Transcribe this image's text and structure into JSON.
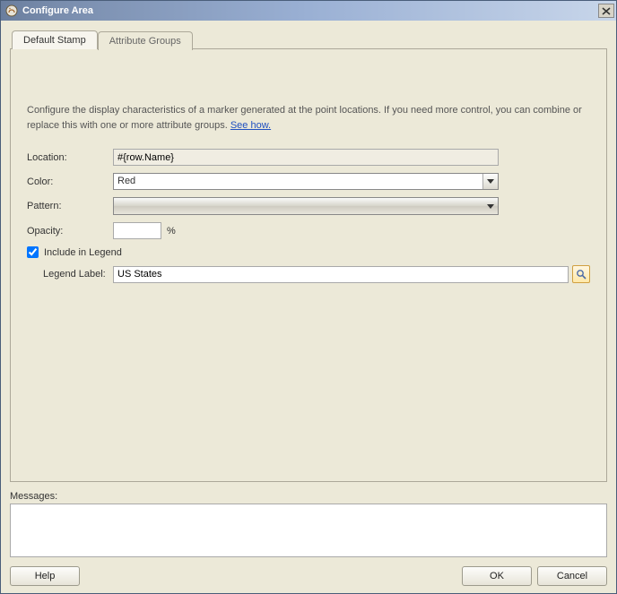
{
  "window": {
    "title": "Configure Area"
  },
  "tabs": {
    "default_stamp": "Default Stamp",
    "attribute_groups": "Attribute Groups"
  },
  "intro": {
    "text": "Configure the display characteristics of a marker generated at the point locations. If you need more control, you can combine or replace this with one or more attribute groups. ",
    "link": "See how."
  },
  "form": {
    "location_label": "Location:",
    "location_value": "#{row.Name}",
    "color_label": "Color:",
    "color_value": "Red",
    "pattern_label": "Pattern:",
    "pattern_value": "",
    "opacity_label": "Opacity:",
    "opacity_value": "",
    "opacity_suffix": "%",
    "include_legend_label": "Include in Legend",
    "include_legend_checked": true,
    "legend_label_label": "Legend Label:",
    "legend_label_value": "US States"
  },
  "messages": {
    "label": "Messages:",
    "value": ""
  },
  "buttons": {
    "help": "Help",
    "ok": "OK",
    "cancel": "Cancel"
  }
}
